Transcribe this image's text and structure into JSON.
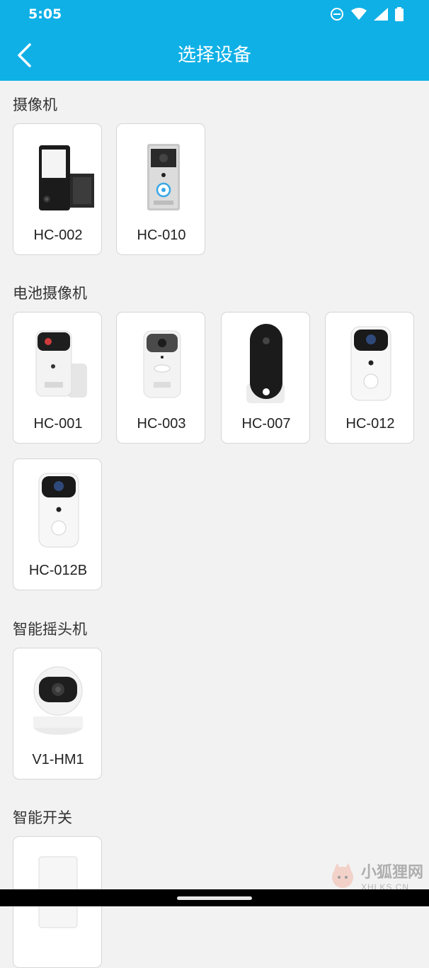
{
  "status_bar": {
    "time": "5:05",
    "icons": [
      "do-not-disturb-icon",
      "wifi-icon",
      "signal-icon",
      "battery-icon"
    ]
  },
  "app_bar": {
    "title": "选择设备",
    "back_icon": "chevron-left-icon"
  },
  "colors": {
    "accent": "#0fb0e6",
    "background": "#f2f2f2"
  },
  "sections": [
    {
      "title": "摄像机",
      "devices": [
        {
          "label": "HC-002"
        },
        {
          "label": "HC-010"
        }
      ]
    },
    {
      "title": "电池摄像机",
      "devices": [
        {
          "label": "HC-001"
        },
        {
          "label": "HC-003"
        },
        {
          "label": "HC-007"
        },
        {
          "label": "HC-012"
        },
        {
          "label": "HC-012B"
        }
      ]
    },
    {
      "title": "智能摇头机",
      "devices": [
        {
          "label": "V1-HM1"
        }
      ]
    },
    {
      "title": "智能开关",
      "devices": [
        {
          "label": ""
        }
      ]
    }
  ],
  "watermark": {
    "text": "小狐狸网",
    "domain": "XHLKS.CN"
  }
}
